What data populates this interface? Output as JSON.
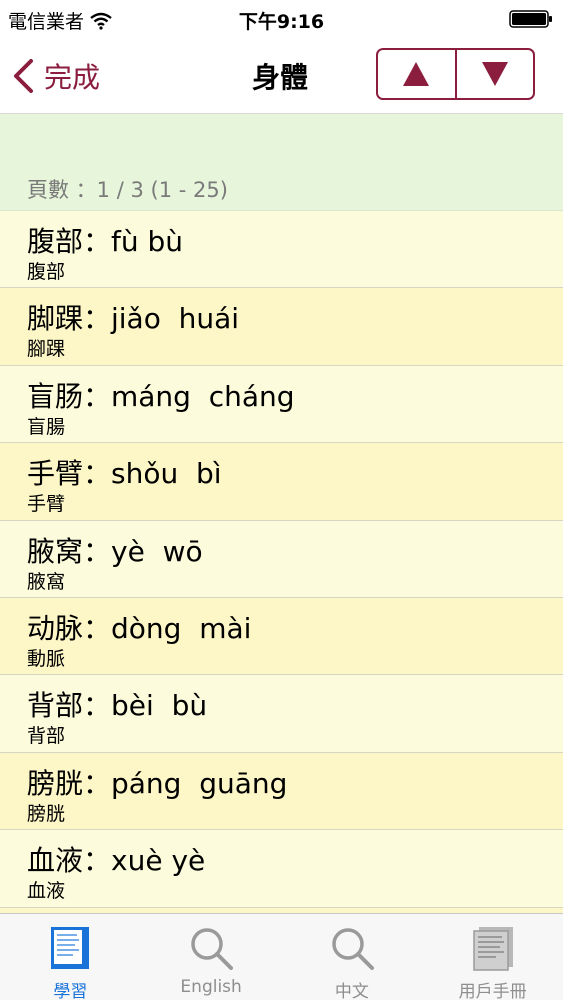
{
  "status": {
    "carrier": "電信業者",
    "time": "下午9:16"
  },
  "nav": {
    "back_label": "完成",
    "title": "身體",
    "prev_symbol": "▲",
    "next_symbol": "▼"
  },
  "page_info": "頁數 ：1 / 3 (1 - 25)",
  "rows": [
    {
      "main": "腹部：fù bù",
      "sub": "腹部"
    },
    {
      "main": "脚踝：jiǎo  huái",
      "sub": "腳踝"
    },
    {
      "main": "盲肠：máng  cháng",
      "sub": "盲腸"
    },
    {
      "main": "手臂：shǒu  bì",
      "sub": "手臂"
    },
    {
      "main": "腋窝：yè  wō",
      "sub": "腋窩"
    },
    {
      "main": "动脉：dòng  mài",
      "sub": "動脈"
    },
    {
      "main": "背部：bèi  bù",
      "sub": "背部"
    },
    {
      "main": "膀胱：páng  guāng",
      "sub": "膀胱"
    },
    {
      "main": "血液：xuè yè",
      "sub": "血液"
    },
    {
      "main": "",
      "sub": ""
    }
  ],
  "tabs": [
    {
      "label": "學習",
      "icon": "book-icon",
      "active": true
    },
    {
      "label": "English",
      "icon": "search-icon",
      "active": false
    },
    {
      "label": "中文",
      "icon": "search-icon",
      "active": false
    },
    {
      "label": "用戶手冊",
      "icon": "manual-icon",
      "active": false
    }
  ],
  "colors": {
    "accent": "#8b1e3f",
    "header_bg": "#e7f6db",
    "row_bg": "#fcfbdc",
    "row_alt_bg": "#fdf6c6",
    "tab_active": "#1a73d9"
  }
}
